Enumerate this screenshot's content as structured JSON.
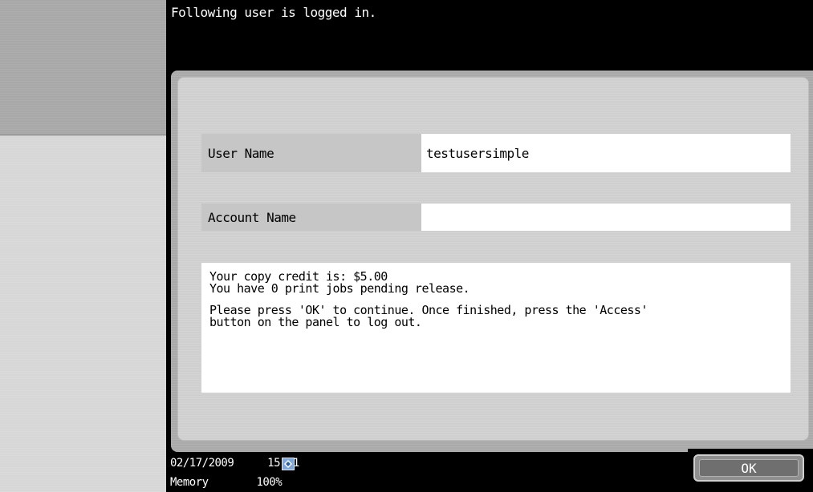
{
  "header": {
    "title": "Following user is logged in."
  },
  "fields": {
    "user_name_label": "User Name",
    "user_name_value": "testusersimple",
    "account_name_label": "Account Name",
    "account_name_value": ""
  },
  "message": {
    "line1": "Your copy credit is: $5.00",
    "line2": "You have 0 print jobs pending release.",
    "line3": "Please press 'OK' to continue. Once finished, press the 'Access'",
    "line4": "button on the panel to log out."
  },
  "status": {
    "date": "02/17/2009",
    "time": "15:41",
    "memory_label": "Memory",
    "memory_value": "100%",
    "network_icon": "network-icon"
  },
  "buttons": {
    "ok_label": "OK"
  }
}
